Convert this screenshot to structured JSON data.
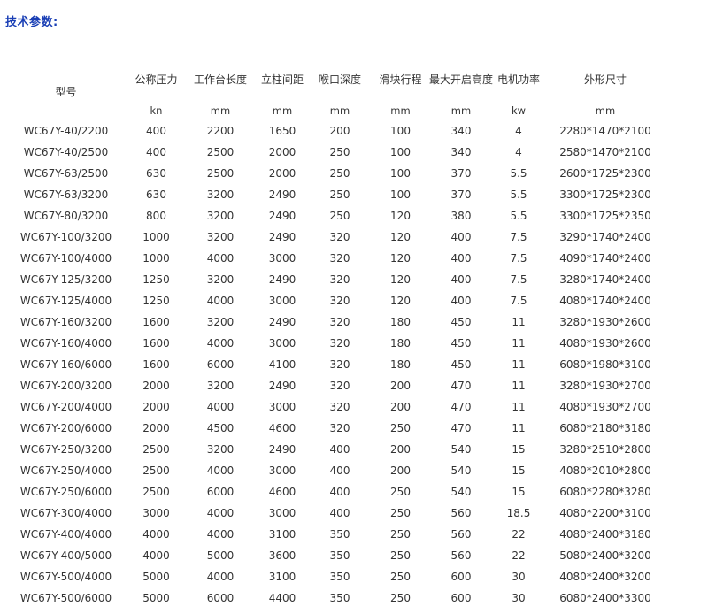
{
  "section_title": "技术参数:",
  "headers": [
    "型号",
    "公称压力",
    "工作台长度",
    "立柱间距",
    "喉口深度",
    "滑块行程",
    "最大开启高度",
    "电机功率",
    "外形尺寸"
  ],
  "units": [
    "",
    "kn",
    "mm",
    "mm",
    "mm",
    "mm",
    "mm",
    "kw",
    "mm"
  ],
  "rows": [
    [
      "WC67Y-40/2200",
      "400",
      "2200",
      "1650",
      "200",
      "100",
      "340",
      "4",
      "2280*1470*2100"
    ],
    [
      "WC67Y-40/2500",
      "400",
      "2500",
      "2000",
      "250",
      "100",
      "340",
      "4",
      "2580*1470*2100"
    ],
    [
      "WC67Y-63/2500",
      "630",
      "2500",
      "2000",
      "250",
      "100",
      "370",
      "5.5",
      "2600*1725*2300"
    ],
    [
      "WC67Y-63/3200",
      "630",
      "3200",
      "2490",
      "250",
      "100",
      "370",
      "5.5",
      "3300*1725*2300"
    ],
    [
      "WC67Y-80/3200",
      "800",
      "3200",
      "2490",
      "250",
      "120",
      "380",
      "5.5",
      "3300*1725*2350"
    ],
    [
      "WC67Y-100/3200",
      "1000",
      "3200",
      "2490",
      "320",
      "120",
      "400",
      "7.5",
      "3290*1740*2400"
    ],
    [
      "WC67Y-100/4000",
      "1000",
      "4000",
      "3000",
      "320",
      "120",
      "400",
      "7.5",
      "4090*1740*2400"
    ],
    [
      "WC67Y-125/3200",
      "1250",
      "3200",
      "2490",
      "320",
      "120",
      "400",
      "7.5",
      "3280*1740*2400"
    ],
    [
      "WC67Y-125/4000",
      "1250",
      "4000",
      "3000",
      "320",
      "120",
      "400",
      "7.5",
      "4080*1740*2400"
    ],
    [
      "WC67Y-160/3200",
      "1600",
      "3200",
      "2490",
      "320",
      "180",
      "450",
      "11",
      "3280*1930*2600"
    ],
    [
      "WC67Y-160/4000",
      "1600",
      "4000",
      "3000",
      "320",
      "180",
      "450",
      "11",
      "4080*1930*2600"
    ],
    [
      "WC67Y-160/6000",
      "1600",
      "6000",
      "4100",
      "320",
      "180",
      "450",
      "11",
      "6080*1980*3100"
    ],
    [
      "WC67Y-200/3200",
      "2000",
      "3200",
      "2490",
      "320",
      "200",
      "470",
      "11",
      "3280*1930*2700"
    ],
    [
      "WC67Y-200/4000",
      "2000",
      "4000",
      "3000",
      "320",
      "200",
      "470",
      "11",
      "4080*1930*2700"
    ],
    [
      "WC67Y-200/6000",
      "2000",
      "4500",
      "4600",
      "320",
      "250",
      "470",
      "11",
      "6080*2180*3180"
    ],
    [
      "WC67Y-250/3200",
      "2500",
      "3200",
      "2490",
      "400",
      "200",
      "540",
      "15",
      "3280*2510*2800"
    ],
    [
      "WC67Y-250/4000",
      "2500",
      "4000",
      "3000",
      "400",
      "200",
      "540",
      "15",
      "4080*2010*2800"
    ],
    [
      "WC67Y-250/6000",
      "2500",
      "6000",
      "4600",
      "400",
      "250",
      "540",
      "15",
      "6080*2280*3280"
    ],
    [
      "WC67Y-300/4000",
      "3000",
      "4000",
      "3000",
      "400",
      "250",
      "560",
      "18.5",
      "4080*2200*3100"
    ],
    [
      "WC67Y-400/4000",
      "4000",
      "4000",
      "3100",
      "350",
      "250",
      "560",
      "22",
      "4080*2400*3180"
    ],
    [
      "WC67Y-400/5000",
      "4000",
      "5000",
      "3600",
      "350",
      "250",
      "560",
      "22",
      "5080*2400*3200"
    ],
    [
      "WC67Y-500/4000",
      "5000",
      "4000",
      "3100",
      "350",
      "250",
      "600",
      "30",
      "4080*2400*3200"
    ],
    [
      "WC67Y-500/6000",
      "5000",
      "6000",
      "4400",
      "350",
      "250",
      "600",
      "30",
      "6080*2400*3300"
    ]
  ]
}
